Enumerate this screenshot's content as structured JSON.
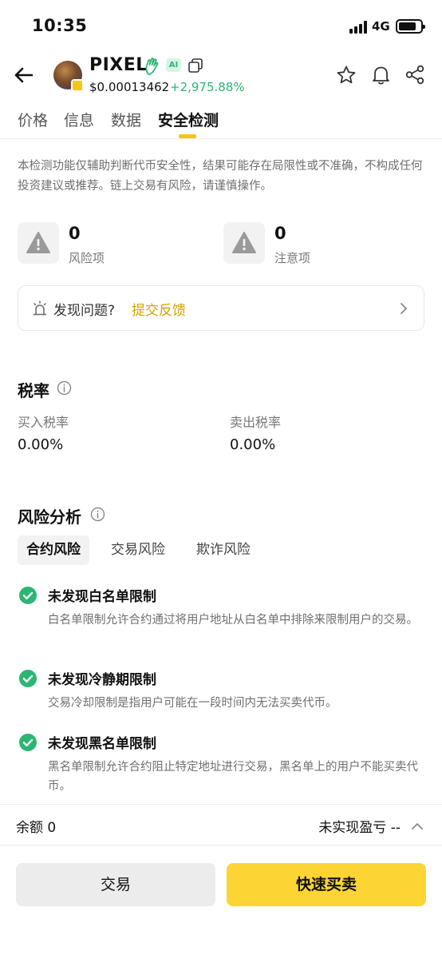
{
  "status_bar": {
    "time": "10:35",
    "network": "4G"
  },
  "header": {
    "coin_name": "PIXEL",
    "ai_badge": "AI",
    "price": "$0.00013462",
    "change": "+2,975.88%",
    "icons": [
      "back-arrow-icon",
      "hand-icon",
      "copy-icon",
      "star-icon",
      "bell-icon",
      "share-icon"
    ]
  },
  "tabs": [
    {
      "label": "价格",
      "active": false
    },
    {
      "label": "信息",
      "active": false
    },
    {
      "label": "数据",
      "active": false
    },
    {
      "label": "安全检测",
      "active": true
    }
  ],
  "disclaimer": "本检测功能仅辅助判断代币安全性，结果可能存在局限性或不准确，不构成任何投资建议或推荐。链上交易有风险，请谨慎操作。",
  "counts": [
    {
      "value": "0",
      "label": "风险项"
    },
    {
      "value": "0",
      "label": "注意项"
    }
  ],
  "feedback": {
    "text": "发现问题?",
    "link": "提交反馈"
  },
  "tax": {
    "title": "税率",
    "buy_label": "买入税率",
    "buy_value": "0.00%",
    "sell_label": "卖出税率",
    "sell_value": "0.00%"
  },
  "risk": {
    "title": "风险分析",
    "tabs": [
      {
        "label": "合约风险",
        "active": true
      },
      {
        "label": "交易风险",
        "active": false
      },
      {
        "label": "欺诈风险",
        "active": false
      }
    ],
    "items": [
      {
        "title": "未发现白名单限制",
        "desc": "白名单限制允许合约通过将用户地址从白名单中排除来限制用户的交易。"
      },
      {
        "title": "未发现冷静期限制",
        "desc": "交易冷却限制是指用户可能在一段时间内无法买卖代币。"
      },
      {
        "title": "未发现黑名单限制",
        "desc": "黑名单限制允许合约阻止特定地址进行交易，黑名单上的用户不能买卖代币。"
      }
    ]
  },
  "bottom": {
    "balance": "余额 0",
    "unrealized": "未实现盈亏 --",
    "trade_button": "交易",
    "quick_button": "快速买卖"
  },
  "colors": {
    "accent": "#fcd535",
    "positive": "#2bb673",
    "link": "#d4a200"
  }
}
